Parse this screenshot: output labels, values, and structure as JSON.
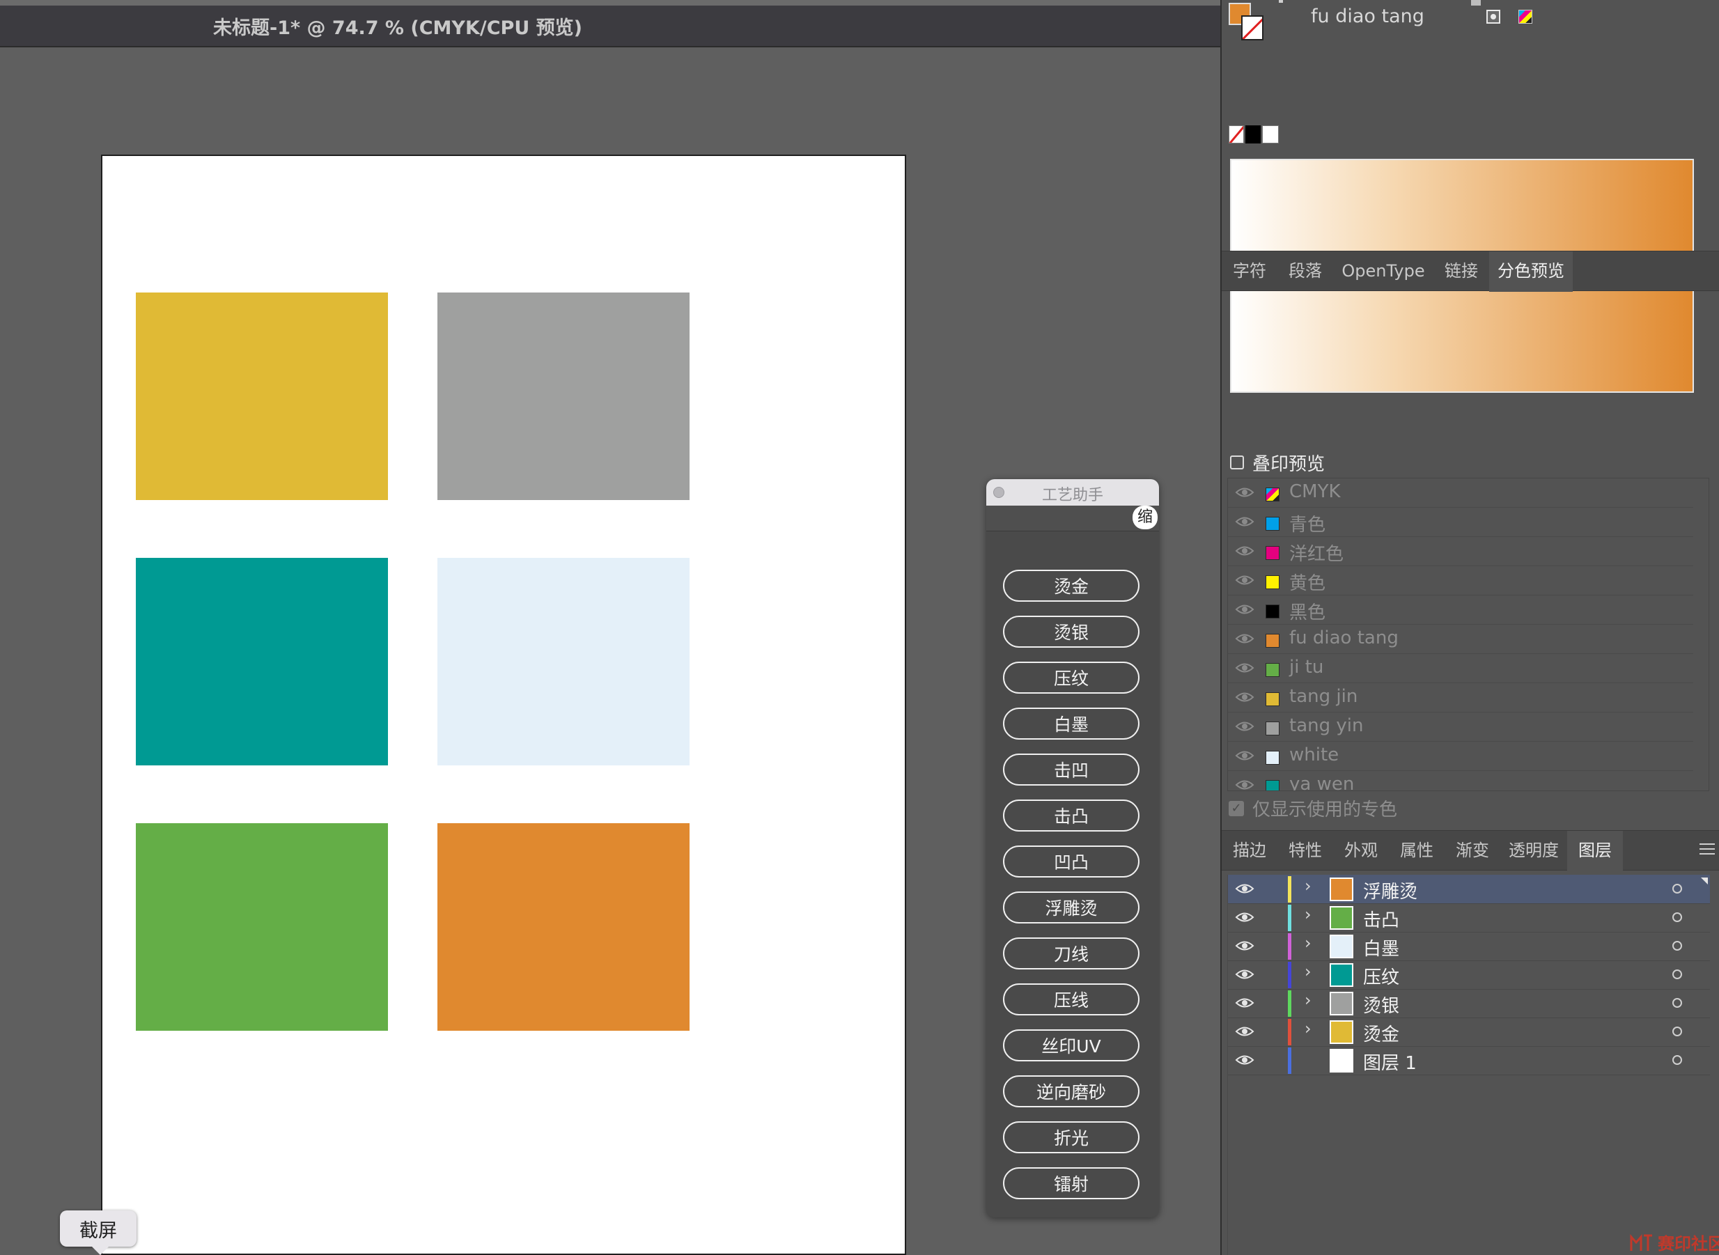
{
  "document": {
    "title": "未标题-1* @ 74.7 % (CMYK/CPU 预览)"
  },
  "artboard": {
    "swatches": [
      {
        "name": "tang jin",
        "color": "#e0ba35"
      },
      {
        "name": "tang yin",
        "color": "#9fa09f"
      },
      {
        "name": "ya wen",
        "color": "#009a93"
      },
      {
        "name": "white",
        "color": "#e4f0f9"
      },
      {
        "name": "ji tu",
        "color": "#64ae47"
      },
      {
        "name": "fu diao tang",
        "color": "#e0892f"
      }
    ]
  },
  "screenshot_tip": {
    "label": "截屏"
  },
  "craft_panel": {
    "title": "工艺助手",
    "minimize_label": "缩小",
    "buttons": [
      "烫金",
      "烫银",
      "压纹",
      "白墨",
      "击凹",
      "击凸",
      "凹凸",
      "浮雕烫",
      "刀线",
      "压线",
      "丝印UV",
      "逆向磨砂",
      "折光",
      "镭射"
    ]
  },
  "swatch_panel": {
    "current_swatch": "fu diao tang",
    "fill_color": "#e0892f",
    "gradient": {
      "from": "#ffffff",
      "to": "#e0892f"
    }
  },
  "type_tabs": {
    "tabs": [
      "字符",
      "段落",
      "OpenType",
      "链接",
      "分色预览"
    ],
    "active": "分色预览"
  },
  "separations": {
    "overprint_label": "叠印预览",
    "overprint_checked": false,
    "rows": [
      {
        "name": "CMYK",
        "color": "cmyk"
      },
      {
        "name": "青色",
        "color": "#00a0e9"
      },
      {
        "name": "洋红色",
        "color": "#e4007f"
      },
      {
        "name": "黄色",
        "color": "#fff100"
      },
      {
        "name": "黑色",
        "color": "#000000"
      },
      {
        "name": "fu diao tang",
        "color": "#e0892f"
      },
      {
        "name": "ji tu",
        "color": "#64ae47"
      },
      {
        "name": "tang jin",
        "color": "#e0ba35"
      },
      {
        "name": "tang yin",
        "color": "#9fa09f"
      },
      {
        "name": "white",
        "color": "#e4f0f9"
      },
      {
        "name": "ya wen",
        "color": "#009a93"
      }
    ],
    "spot_only_label": "仅显示使用的专色",
    "spot_only_checked": true
  },
  "layer_tabs": {
    "tabs": [
      "描边",
      "特性",
      "外观",
      "属性",
      "渐变",
      "透明度",
      "图层"
    ],
    "active": "图层"
  },
  "layers": [
    {
      "name": "浮雕烫",
      "color_bar": "#f3e35b",
      "thumb": "#e0892f",
      "expandable": true,
      "selected": true
    },
    {
      "name": "击凸",
      "color_bar": "#6fe0e0",
      "thumb": "#64ae47",
      "expandable": true,
      "selected": false
    },
    {
      "name": "白墨",
      "color_bar": "#d061d8",
      "thumb": "#e4f0f9",
      "expandable": true,
      "selected": false
    },
    {
      "name": "压纹",
      "color_bar": "#4545d8",
      "thumb": "#009a93",
      "expandable": true,
      "selected": false
    },
    {
      "name": "烫银",
      "color_bar": "#5ed85e",
      "thumb": "#9fa09f",
      "expandable": true,
      "selected": false
    },
    {
      "name": "烫金",
      "color_bar": "#e0503c",
      "thumb": "#e0ba35",
      "expandable": true,
      "selected": false
    },
    {
      "name": "图层 1",
      "color_bar": "#4a6fe0",
      "thumb": "#ffffff",
      "expandable": false,
      "selected": false
    }
  ],
  "watermark": {
    "text": "赛印社区"
  }
}
